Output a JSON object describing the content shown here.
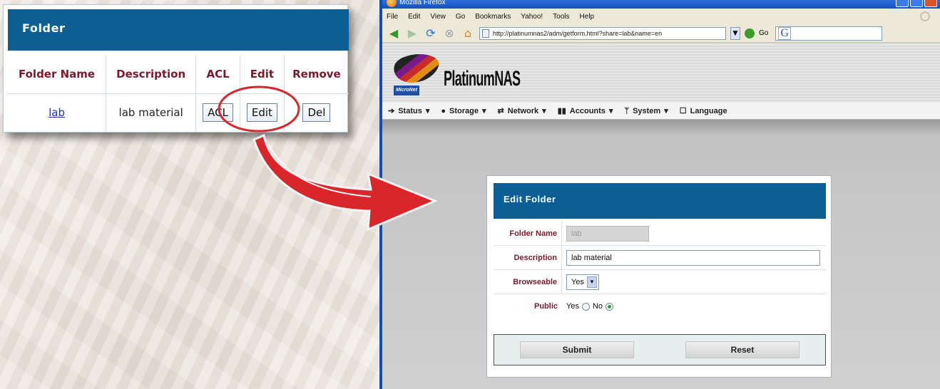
{
  "folder_panel": {
    "title": "Folder",
    "columns": [
      "Folder Name",
      "Description",
      "ACL",
      "Edit",
      "Remove"
    ],
    "row": {
      "name": "lab",
      "description": "lab material",
      "acl_button": "ACL",
      "edit_button": "Edit",
      "del_button": "Del"
    }
  },
  "browser": {
    "title": "Mozilla Firefox",
    "menu": [
      "File",
      "Edit",
      "View",
      "Go",
      "Bookmarks",
      "Yahoo!",
      "Tools",
      "Help"
    ],
    "url": "http://platinumnas2/adm/getform.html?share=lab&name=en",
    "go_label": "Go",
    "search_logo": "G"
  },
  "nas": {
    "brand_title": "PlatinumNAS",
    "brand_badge": "MicroNet",
    "nav": [
      {
        "label": "Status",
        "icon": "status-icon"
      },
      {
        "label": "Storage",
        "icon": "storage-icon"
      },
      {
        "label": "Network",
        "icon": "network-icon"
      },
      {
        "label": "Accounts",
        "icon": "accounts-icon"
      },
      {
        "label": "System",
        "icon": "system-icon"
      },
      {
        "label": "Language",
        "icon": "language-icon"
      }
    ]
  },
  "edit_folder": {
    "title": "Edit Folder",
    "folder_name_label": "Folder Name",
    "folder_name_value": "lab",
    "description_label": "Description",
    "description_value": "lab material",
    "browseable_label": "Browseable",
    "browseable_value": "Yes",
    "public_label": "Public",
    "public_yes": "Yes",
    "public_no": "No",
    "public_selected": "No",
    "submit_label": "Submit",
    "reset_label": "Reset"
  },
  "colors": {
    "header_blue": "#0b5f95",
    "label_maroon": "#7a1b2b",
    "annotation_red": "#d9262b",
    "xp_blue": "#0d4fb5"
  }
}
